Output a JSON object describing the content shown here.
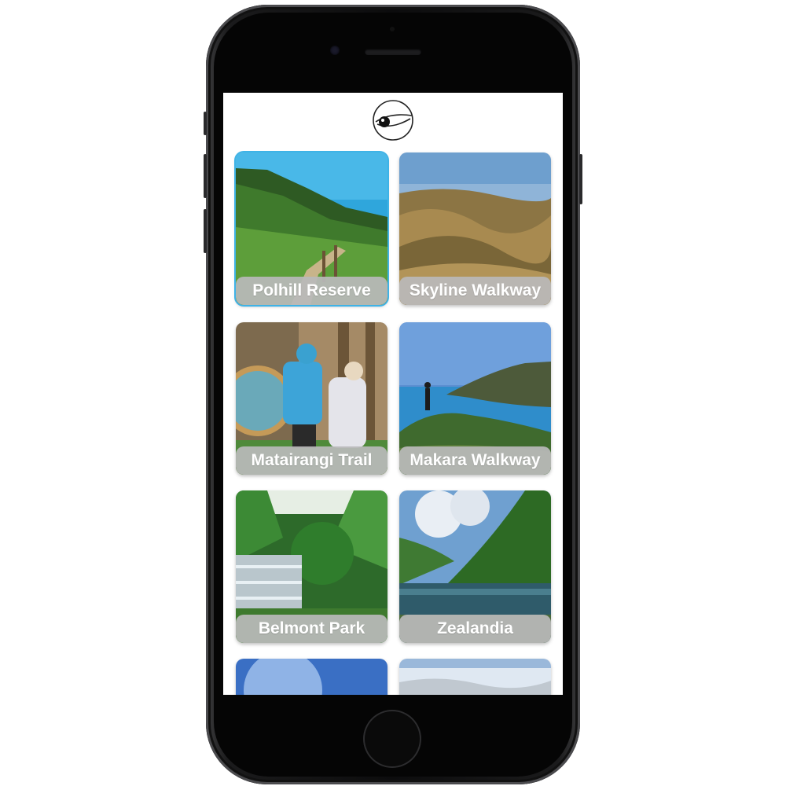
{
  "app": {
    "logo_icon": "eye-logo-icon"
  },
  "walks": [
    {
      "label": "Polhill Reserve",
      "selected": true
    },
    {
      "label": "Skyline Walkway",
      "selected": false
    },
    {
      "label": "Matairangi Trail",
      "selected": false
    },
    {
      "label": "Makara Walkway",
      "selected": false
    },
    {
      "label": "Belmont Park",
      "selected": false
    },
    {
      "label": "Zealandia",
      "selected": false
    },
    {
      "label": "",
      "selected": false
    },
    {
      "label": "",
      "selected": false
    }
  ],
  "colors": {
    "selected_outline": "#3fb3e6",
    "label_background": "#b9b9b9",
    "label_text": "#ffffff"
  }
}
